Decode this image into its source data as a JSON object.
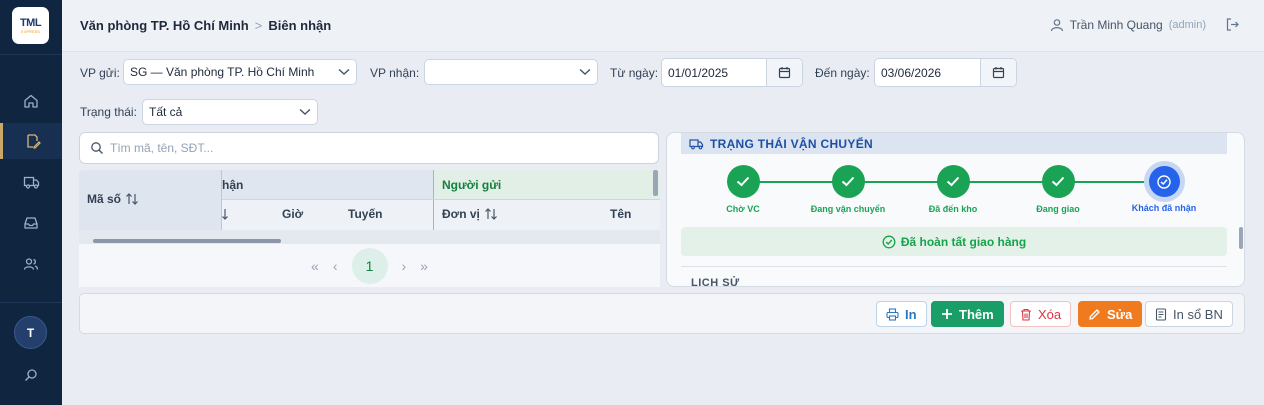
{
  "app": {
    "logo_text": "TML",
    "logo_sub": "EXPRESS"
  },
  "sidebar": {
    "items": [
      {
        "name": "home-icon"
      },
      {
        "name": "receipt-edit-icon",
        "active": true
      },
      {
        "name": "truck-icon"
      },
      {
        "name": "inbox-icon"
      },
      {
        "name": "users-icon"
      }
    ],
    "avatar_initial": "T",
    "search_icon": "search-icon"
  },
  "header": {
    "breadcrumb_office": "Văn phòng TP. Hồ Chí Minh",
    "breadcrumb_sep": ">",
    "breadcrumb_page": "Biên nhận",
    "user_name": "Trần Minh Quang",
    "user_role": "(admin)"
  },
  "filters": {
    "vp_gui_label": "VP gửi:",
    "vp_gui_value": "SG — Văn phòng TP. Hồ Chí Minh",
    "vp_nhan_label": "VP nhận:",
    "vp_nhan_value": "",
    "tu_ngay_label": "Từ ngày:",
    "tu_ngay_value": "01/01/2025",
    "den_ngay_label": "Đến ngày:",
    "den_ngay_value": "03/06/2026",
    "trang_thai_label": "Trạng thái:",
    "trang_thai_value": "Tất cả"
  },
  "search": {
    "placeholder": "Tìm mã, tên, SĐT..."
  },
  "table": {
    "frozen_header": "Mã số",
    "group_nhan_partial": "hận",
    "group_nguoi_gui": "Người gửi",
    "col_gio": "Giờ",
    "col_tuyen": "Tuyến",
    "col_don_vi": "Đơn vị",
    "col_ten": "Tên"
  },
  "pagination": {
    "first": "«",
    "prev": "‹",
    "current": "1",
    "next": "›",
    "last": "»"
  },
  "status_panel": {
    "title": "TRẠNG THÁI VẬN CHUYỂN",
    "steps": [
      "Chờ VC",
      "Đang vận chuyển",
      "Đã đến kho",
      "Đang giao",
      "Khách đã nhận"
    ],
    "current_step_index": 4,
    "completed_message": "Đã hoàn tất giao hàng",
    "history_label": "LỊCH SỬ"
  },
  "toolbar": {
    "print_label": "In",
    "add_label": "Thêm",
    "delete_label": "Xóa",
    "edit_label": "Sửa",
    "print_book_label": "In sổ BN"
  },
  "colors": {
    "sidebar_bg": "#0f2540",
    "success_green": "#1aa355",
    "current_blue": "#2563eb",
    "add_button": "#189e66",
    "edit_button": "#f07a1e",
    "delete_text": "#dc3545"
  }
}
